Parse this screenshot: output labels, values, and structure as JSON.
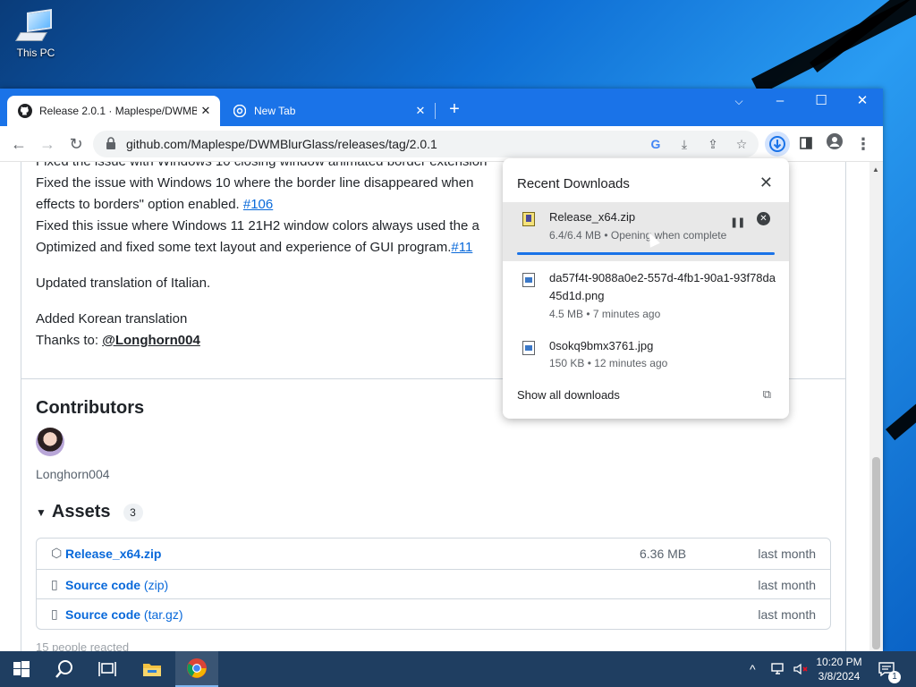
{
  "desktop": {
    "icon_label": "This PC"
  },
  "browser": {
    "tabs": [
      {
        "title": "Release 2.0.1 · Maplespe/DWMBlurGlass",
        "icon": "github-icon",
        "active": true
      },
      {
        "title": "New Tab",
        "icon": "chrome-icon",
        "active": false
      }
    ],
    "url": "github.com/Maplespe/DWMBlurGlass/releases/tag/2.0.1"
  },
  "page": {
    "lines": [
      "Fixed the issue with Windows 10 closing window animated border extension",
      "Fixed the issue with Windows 10 where the border line disappeared when ",
      "effects to borders\" option enabled. ",
      "Fixed this issue where Windows 11 21H2 window colors always used the a",
      "Optimized and fixed some text layout and experience of GUI program."
    ],
    "link_106": "#106",
    "link_11": "#11",
    "italian": "Updated translation of Italian.",
    "korean": "Added Korean translation",
    "thanks_prefix": "Thanks to: ",
    "thanks_user": "@Longhorn004",
    "contributors_heading": "Contributors",
    "contributor_name": "Longhorn004",
    "assets_heading": "Assets",
    "assets_count": "3",
    "assets": [
      {
        "name": "Release_x64.zip",
        "sub": "",
        "size": "6.36 MB",
        "date": "last month",
        "icon": "package-icon"
      },
      {
        "name": "Source code",
        "sub": " (zip)",
        "size": "",
        "date": "last month",
        "icon": "zip-file-icon"
      },
      {
        "name": "Source code",
        "sub": " (tar.gz)",
        "size": "",
        "date": "last month",
        "icon": "zip-file-icon"
      }
    ],
    "reactions_text": "15 people reacted"
  },
  "downloads": {
    "title": "Recent Downloads",
    "items": [
      {
        "name": "Release_x64.zip",
        "meta": "6.4/6.4 MB • Opening when complete",
        "progress": 1.0
      },
      {
        "name": "da57f4t-9088a0e2-557d-4fb1-90a1-93f78da45d1d.png",
        "meta": "4.5 MB • 7 minutes ago"
      },
      {
        "name": "0sokq9bmx3761.jpg",
        "meta": "150 KB • 12 minutes ago"
      }
    ],
    "show_all": "Show all downloads"
  },
  "taskbar": {
    "time": "10:20 PM",
    "date": "3/8/2024",
    "notification_count": "1"
  }
}
